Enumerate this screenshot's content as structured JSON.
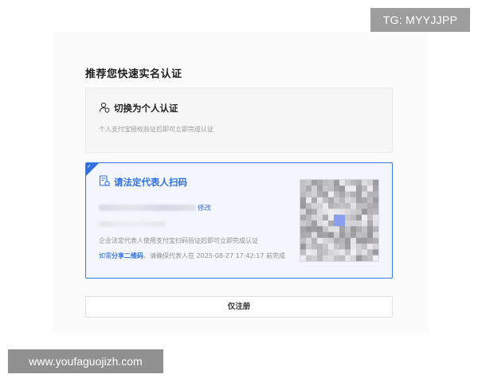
{
  "page": {
    "title": "推荐您快速实名认证"
  },
  "personal_card": {
    "title": "切换为个人认证",
    "description": "个人支付宝授权验证后即可立即完成认证",
    "icon": "user-shield-icon"
  },
  "legal_card": {
    "title": "请法定代表人扫码",
    "icon": "document-scan-icon",
    "modify_label": "修改",
    "description": "企业法定代表人使用支付宝扫码验证后即可立即完成认证",
    "share_prefix": "如需",
    "share_link": "分享二维码",
    "share_suffix": "，请确保代表人在 2025-08-27 17:42:17 前完成",
    "accent_color": "#2f6fe0"
  },
  "register_button": {
    "label": "仅注册"
  },
  "watermarks": {
    "top": "TG: MYYJJPP",
    "bottom": "www.youfaguojizh.com"
  }
}
